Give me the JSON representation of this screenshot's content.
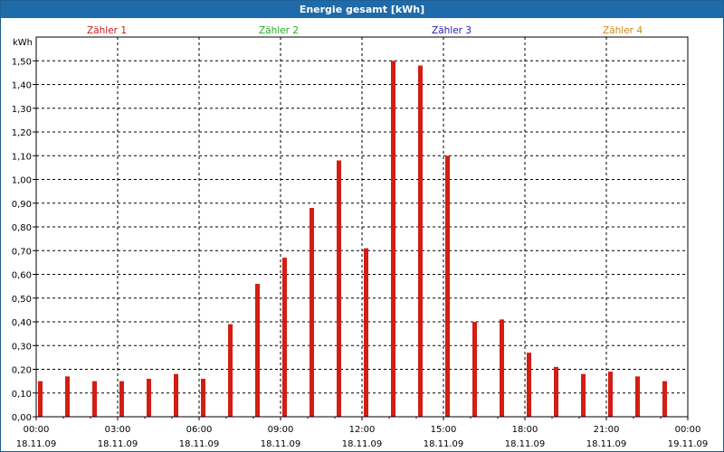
{
  "title": "Energie gesamt [kWh]",
  "colors": {
    "titlebar": "#1f6aa8",
    "bar": "#d21e14",
    "series": [
      "#cc1a1a",
      "#1fae1f",
      "#1f1fb0",
      "#d08a10"
    ]
  },
  "chart_data": {
    "type": "bar",
    "title": "Energie gesamt [kWh]",
    "ylabel": "kWh",
    "ylim": [
      0,
      1.6
    ],
    "grid": true,
    "legend_placement": "top",
    "legend": [
      "Zähler 1",
      "Zähler 2",
      "Zähler 3",
      "Zähler 4"
    ],
    "yticks": [
      "0,00",
      "0,10",
      "0,20",
      "0,30",
      "0,40",
      "0,50",
      "0,60",
      "0,70",
      "0,80",
      "0,90",
      "1,00",
      "1,10",
      "1,20",
      "1,30",
      "1,40",
      "1,50"
    ],
    "xticks": [
      {
        "time": "00:00",
        "date": "18.11.09"
      },
      {
        "time": "03:00",
        "date": "18.11.09"
      },
      {
        "time": "06:00",
        "date": "18.11.09"
      },
      {
        "time": "09:00",
        "date": "18.11.09"
      },
      {
        "time": "12:00",
        "date": "18.11.09"
      },
      {
        "time": "15:00",
        "date": "18.11.09"
      },
      {
        "time": "18:00",
        "date": "18.11.09"
      },
      {
        "time": "21:00",
        "date": "18.11.09"
      },
      {
        "time": "00:00",
        "date": "19.11.09"
      }
    ],
    "x_hours": [
      0,
      1,
      2,
      3,
      4,
      5,
      6,
      7,
      8,
      9,
      10,
      11,
      12,
      13,
      14,
      15,
      16,
      17,
      18,
      19,
      20,
      21,
      22,
      23
    ],
    "series": [
      {
        "values": [
          0.15,
          0.17,
          0.15,
          0.15,
          0.16,
          0.18,
          0.16,
          0.39,
          0.56,
          0.67,
          0.88,
          1.08,
          0.71,
          1.5,
          1.48,
          1.1,
          0.4,
          0.41,
          0.27,
          0.21,
          0.18,
          0.19,
          0.17,
          0.15
        ]
      }
    ]
  }
}
